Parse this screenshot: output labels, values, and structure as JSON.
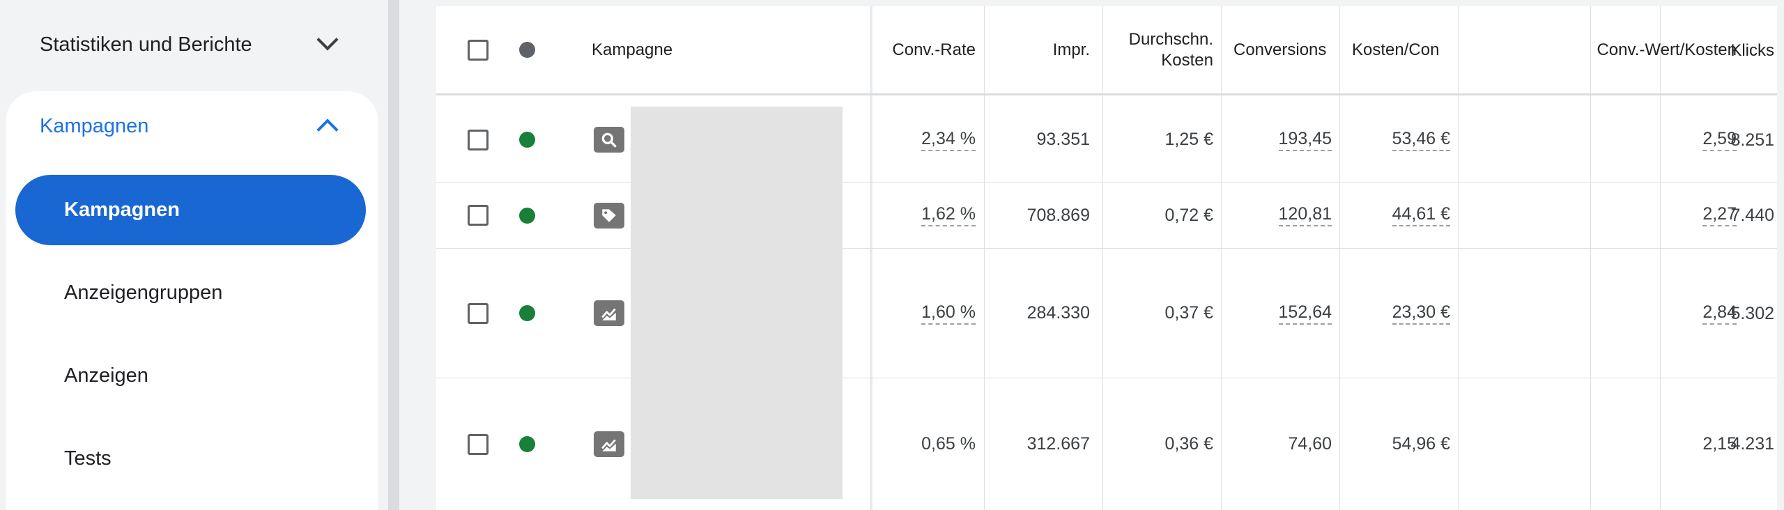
{
  "sidebar": {
    "section_title": "Statistiken und Berichte",
    "group_title": "Kampagnen",
    "items": [
      {
        "label": "Kampagnen",
        "active": true
      },
      {
        "label": "Anzeigengruppen",
        "active": false
      },
      {
        "label": "Anzeigen",
        "active": false
      },
      {
        "label": "Tests",
        "active": false
      }
    ]
  },
  "table": {
    "columns": {
      "campaign": "Kampagne",
      "conv_rate": "Conv.-Rate",
      "impr": "Impr.",
      "avg_cost_line1": "Durchschn.",
      "avg_cost_line2": "Kosten",
      "conversions": "Conversions",
      "cost_per_conv": "Kosten/Con",
      "conv_value_cost": "Conv.-Wert/Kosten",
      "clicks": "Klicks"
    },
    "rows": [
      {
        "type_icon": "search-icon",
        "status": "enabled",
        "conv_rate": "2,34 %",
        "impr": "93.351",
        "avg_cost": "1,25 €",
        "conversions": "193,45",
        "cost_per_conv": "53,46 €",
        "conv_value_cost": "2,59",
        "clicks": "8.251"
      },
      {
        "type_icon": "tag-icon",
        "status": "enabled",
        "conv_rate": "1,62 %",
        "impr": "708.869",
        "avg_cost": "0,72 €",
        "conversions": "120,81",
        "cost_per_conv": "44,61 €",
        "conv_value_cost": "2,27",
        "clicks": "7.440"
      },
      {
        "type_icon": "performance-icon",
        "status": "enabled",
        "conv_rate": "1,60 %",
        "impr": "284.330",
        "avg_cost": "0,37 €",
        "conversions": "152,64",
        "cost_per_conv": "23,30 €",
        "conv_value_cost": "2,84",
        "clicks": "5.302"
      },
      {
        "type_icon": "performance-icon",
        "status": "enabled",
        "conv_rate": "0,65 %",
        "impr": "312.667",
        "avg_cost": "0,36 €",
        "conversions": "74,60",
        "cost_per_conv": "54,96 €",
        "conv_value_cost": "2,15",
        "clicks": "4.231"
      }
    ]
  },
  "colors": {
    "accent": "#1967d2",
    "link": "#1a73e8",
    "status_enabled": "#188038"
  }
}
